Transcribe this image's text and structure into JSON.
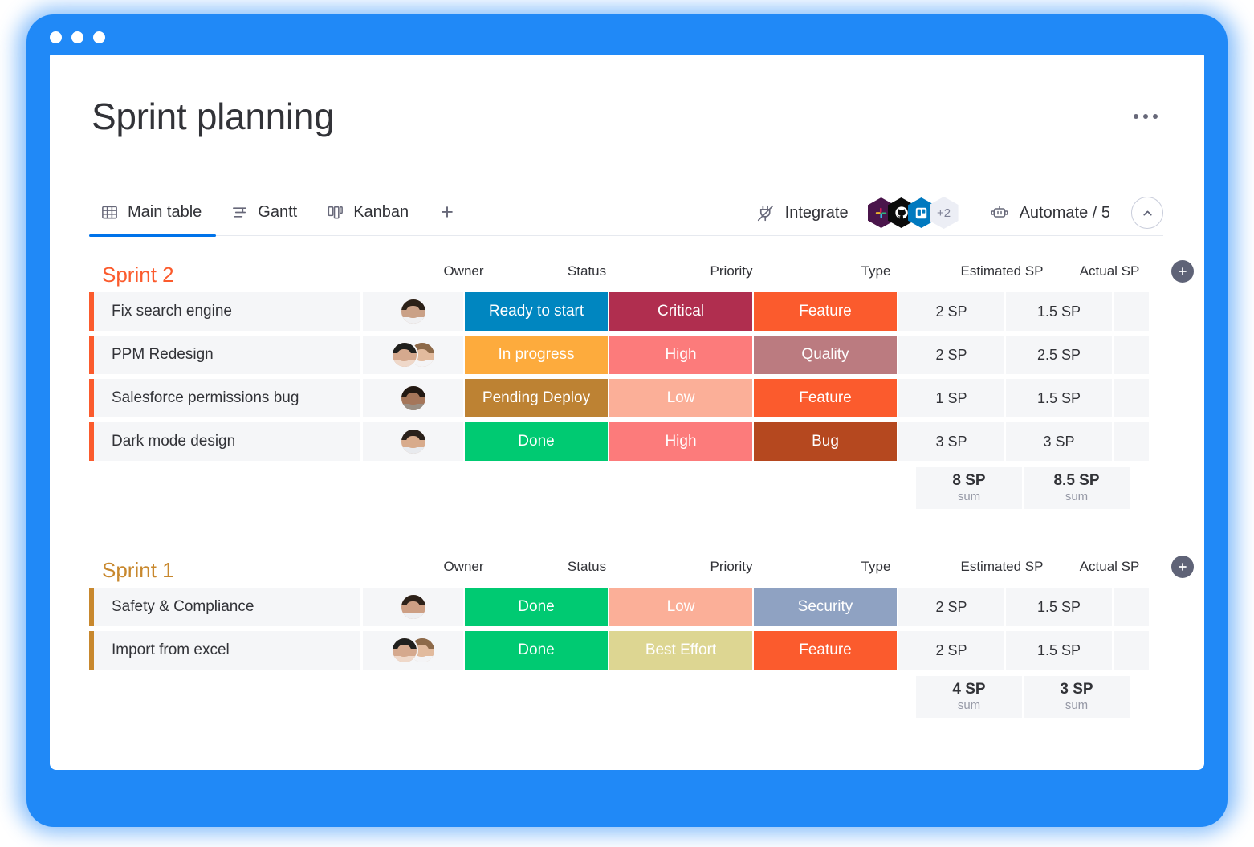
{
  "window": {
    "dots": [
      "close",
      "minimize",
      "maximize"
    ],
    "frame_color": "#2089f7"
  },
  "header": {
    "title": "Sprint planning",
    "menu_icon": "kebab-menu-icon"
  },
  "tabs": [
    {
      "label": "Main table",
      "icon": "table-icon",
      "active": true
    },
    {
      "label": "Gantt",
      "icon": "gantt-icon",
      "active": false
    },
    {
      "label": "Kanban",
      "icon": "kanban-icon",
      "active": false
    }
  ],
  "tab_add_label": "+",
  "toolbar": {
    "integrate_label": "Integrate",
    "integrate_icon": "plug-icon",
    "integrations": [
      {
        "name": "slack-icon",
        "color": "#4a154b"
      },
      {
        "name": "github-icon",
        "color": "#0b0b0b"
      },
      {
        "name": "trello-icon",
        "color": "#0079bf"
      }
    ],
    "integrations_more": "+2",
    "automate_label": "Automate / 5",
    "automate_icon": "robot-icon",
    "collapse_icon": "chevron-up-icon"
  },
  "columns": [
    "Owner",
    "Status",
    "Priority",
    "Type",
    "Estimated SP",
    "Actual SP"
  ],
  "add_column_label": "+",
  "groups": [
    {
      "title": "Sprint 2",
      "color": "#fb5b2d",
      "rows": [
        {
          "name": "Fix search engine",
          "owners": [
            {
              "skin": "#caa187",
              "hair": "#2b2118",
              "body": "#f0f0f2"
            }
          ],
          "status": {
            "text": "Ready to start",
            "color": "#0086c0"
          },
          "priority": {
            "text": "Critical",
            "color": "#b02e4f"
          },
          "type": {
            "text": "Feature",
            "color": "#fb5b2d"
          },
          "estimated": "2 SP",
          "actual": "1.5 SP"
        },
        {
          "name": "PPM Redesign",
          "owners": [
            {
              "skin": "#d5a98e",
              "hair": "#20201e",
              "body": "#efd8c9"
            },
            {
              "skin": "#e2bb9e",
              "hair": "#8d6a4a",
              "body": "#f4f4f6"
            }
          ],
          "status": {
            "text": "In progress",
            "color": "#fdab3d"
          },
          "priority": {
            "text": "High",
            "color": "#fc7b7b"
          },
          "type": {
            "text": "Quality",
            "color": "#bb7b80"
          },
          "estimated": "2 SP",
          "actual": "2.5 SP"
        },
        {
          "name": "Salesforce permissions bug",
          "owners": [
            {
              "skin": "#a5765a",
              "hair": "#221913",
              "body": "#9a8f84"
            }
          ],
          "status": {
            "text": "Pending Deploy",
            "color": "#bd8233"
          },
          "priority": {
            "text": "Low",
            "color": "#fbaf98"
          },
          "type": {
            "text": "Feature",
            "color": "#fb5b2d"
          },
          "estimated": "1 SP",
          "actual": "1.5 SP"
        },
        {
          "name": "Dark mode design",
          "owners": [
            {
              "skin": "#d8ab8c",
              "hair": "#2a211b",
              "body": "#e8eaee"
            }
          ],
          "status": {
            "text": "Done",
            "color": "#00ca72"
          },
          "priority": {
            "text": "High",
            "color": "#fc7b7b"
          },
          "type": {
            "text": "Bug",
            "color": "#b5481f"
          },
          "estimated": "3 SP",
          "actual": "3 SP"
        }
      ],
      "sums": [
        {
          "value": "8 SP",
          "label": "sum"
        },
        {
          "value": "8.5 SP",
          "label": "sum"
        }
      ]
    },
    {
      "title": "Sprint 1",
      "color": "#c8882e",
      "rows": [
        {
          "name": "Safety & Compliance",
          "owners": [
            {
              "skin": "#cd9f84",
              "hair": "#2c2119",
              "body": "#eeeff2"
            }
          ],
          "status": {
            "text": "Done",
            "color": "#00ca72"
          },
          "priority": {
            "text": "Low",
            "color": "#fbaf98"
          },
          "type": {
            "text": "Security",
            "color": "#8fa2c2"
          },
          "estimated": "2 SP",
          "actual": "1.5 SP"
        },
        {
          "name": "Import from excel",
          "owners": [
            {
              "skin": "#d5a98e",
              "hair": "#20201e",
              "body": "#efd8c9"
            },
            {
              "skin": "#e2bb9e",
              "hair": "#8d6a4a",
              "body": "#f4f4f6"
            }
          ],
          "status": {
            "text": "Done",
            "color": "#00ca72"
          },
          "priority": {
            "text": "Best Effort",
            "color": "#ddd692"
          },
          "type": {
            "text": "Feature",
            "color": "#fb5b2d"
          },
          "estimated": "2 SP",
          "actual": "1.5 SP"
        }
      ],
      "sums": [
        {
          "value": "4 SP",
          "label": "sum"
        },
        {
          "value": "3 SP",
          "label": "sum"
        }
      ]
    }
  ]
}
